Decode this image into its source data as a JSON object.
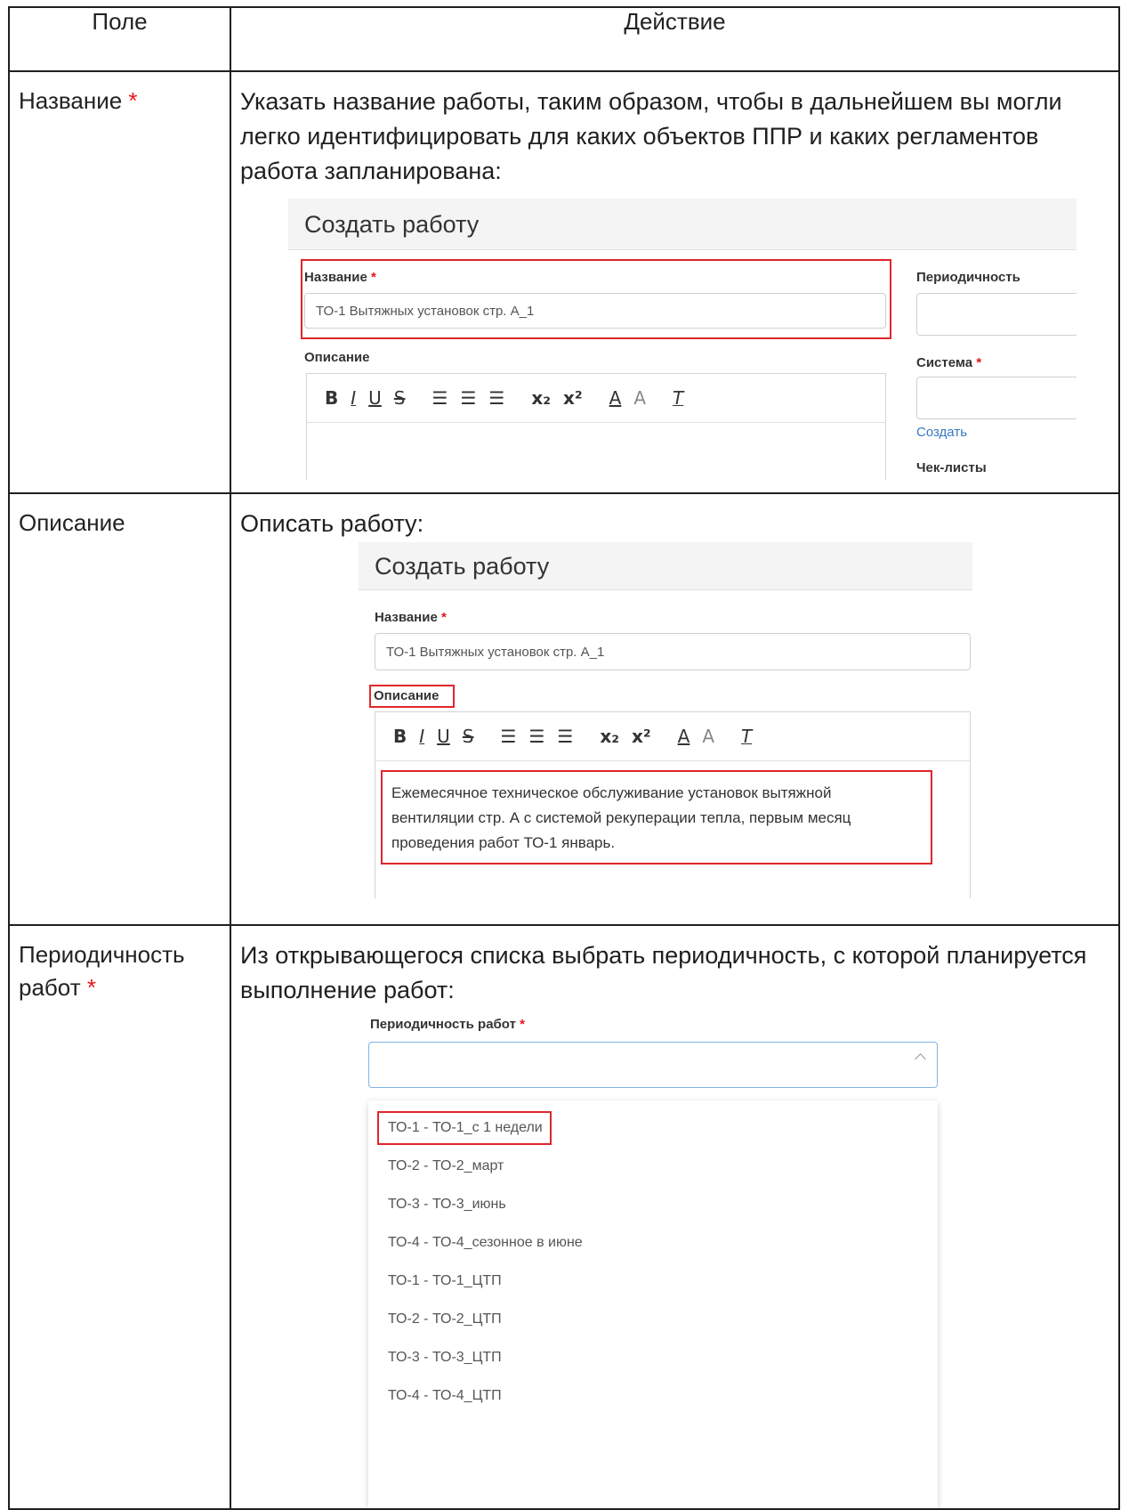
{
  "table": {
    "headers": {
      "field": "Поле",
      "action": "Действие"
    },
    "rows": [
      {
        "field": "Название",
        "required_mark": "*",
        "action": "Указать название работы, таким образом, чтобы в дальнейшем вы могли легко идентифицировать для каких объектов ППР и каких регламентов работа запланирована:"
      },
      {
        "field": "Описание",
        "action": "Описать работу:"
      },
      {
        "field": "Периодичность работ",
        "required_mark": "*",
        "action": "Из открывающегося списка выбрать периодичность, с которой планируется выполнение работ:"
      }
    ]
  },
  "shot1": {
    "panel_title": "Создать работу",
    "name_label": "Название",
    "required_mark": "*",
    "name_value": "ТО-1 Вытяжных установок стр. А_1",
    "description_label": "Описание",
    "period_label": "Периодичность",
    "system_label": "Система",
    "create_link": "Создать",
    "checklists_label": "Чек-листы"
  },
  "toolbar": {
    "bold": "B",
    "italic": "I",
    "underline": "U",
    "strike": "S",
    "ordered_list": "☰",
    "bullet_list": "☰",
    "check_list": "☰",
    "subscript": "x₂",
    "superscript": "x²",
    "font_color": "A",
    "highlight": "A",
    "clear_format": "T"
  },
  "shot2": {
    "panel_title": "Создать работу",
    "name_label": "Название",
    "required_mark": "*",
    "name_value": "ТО-1 Вытяжных установок стр. А_1",
    "description_label": "Описание",
    "description_text": "Ежемесячное техническое обслуживание установок вытяжной вентиляции стр. А с системой рекуперации тепла, первым месяц проведения работ ТО-1 январь."
  },
  "shot3": {
    "label": "Периодичность работ",
    "required_mark": "*",
    "options": [
      "ТО-1 - ТО-1_с 1 недели",
      "ТО-2 - ТО-2_март",
      "ТО-3 - ТО-3_июнь",
      "ТО-4 - ТО-4_сезонное в июне",
      "ТО-1 - ТО-1_ЦТП",
      "ТО-2 - ТО-2_ЦТП",
      "ТО-3 - ТО-3_ЦТП",
      "ТО-4 - ТО-4_ЦТП"
    ]
  },
  "colors": {
    "required": "#e8141b",
    "highlight_box": "#e0262c",
    "link": "#3a78c3"
  }
}
